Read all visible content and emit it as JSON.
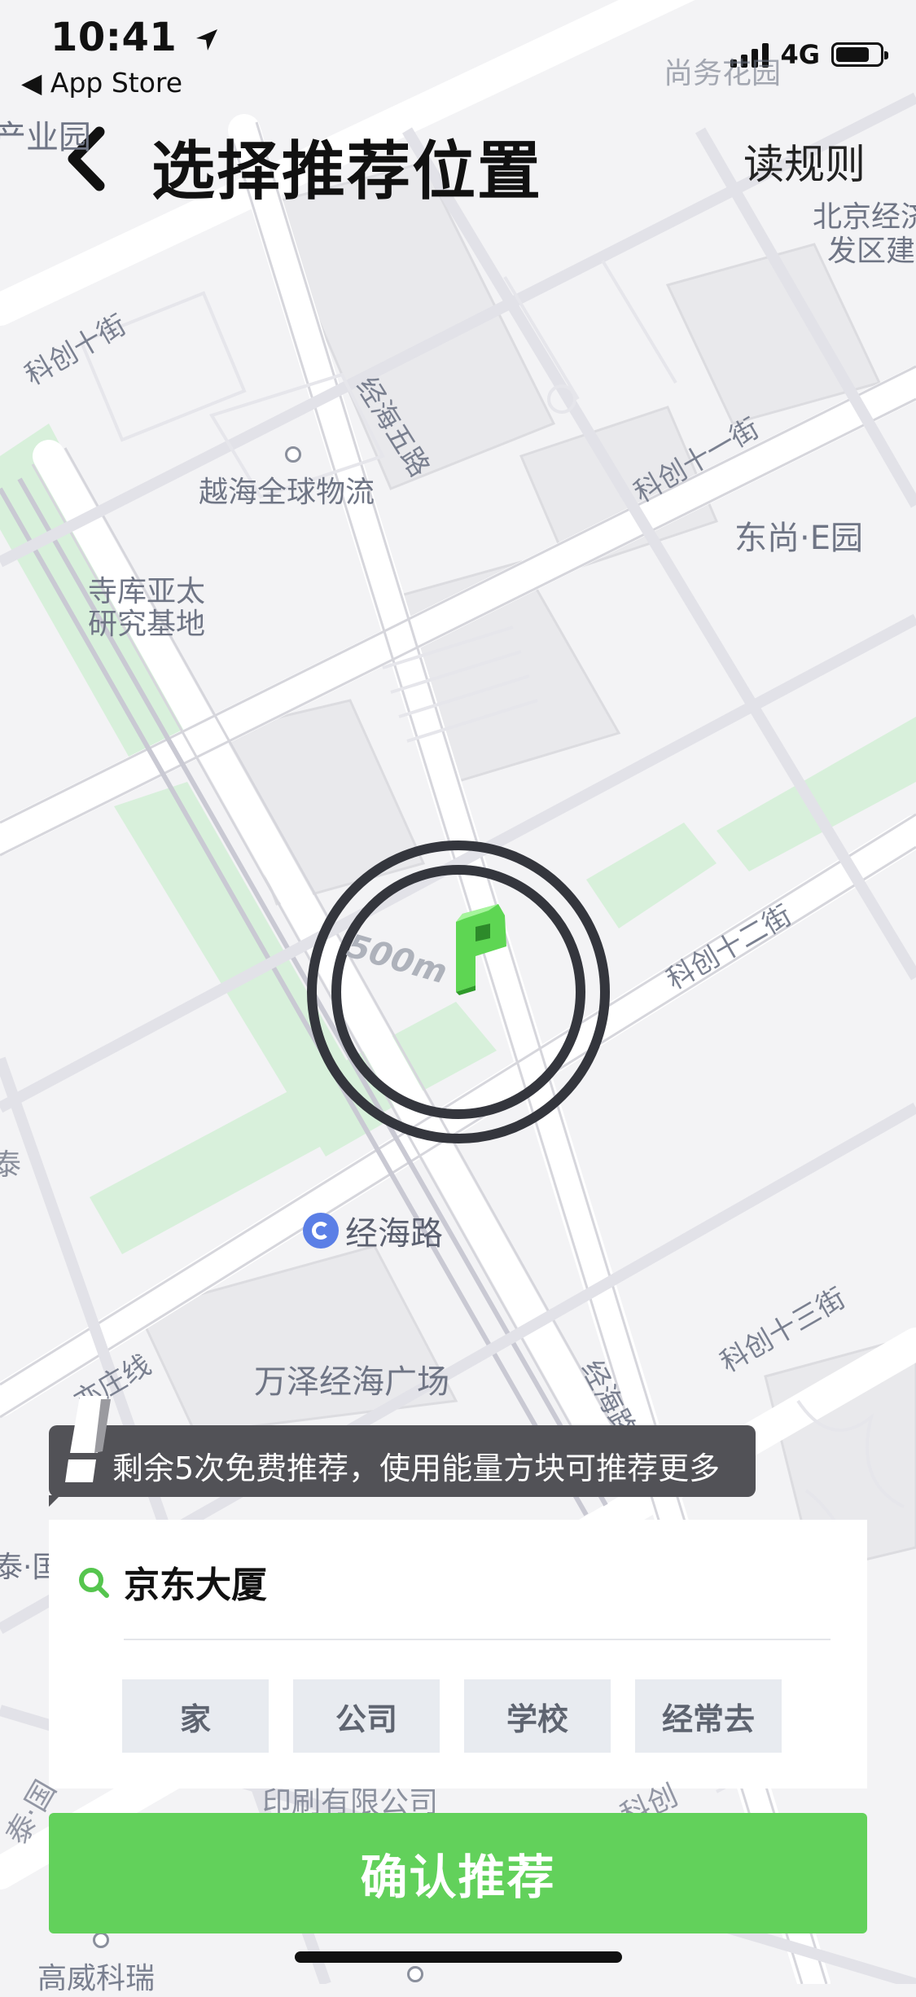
{
  "status_bar": {
    "time": "10:41",
    "back_app": "◀ App Store",
    "network": "4G",
    "battery_level": 0.8
  },
  "nav": {
    "title": "选择推荐位置",
    "rules_label": "读规则"
  },
  "map": {
    "places": {
      "industrial_park": "产业园",
      "north_cut": "尚务花园",
      "econ_zone_1": "北京经济",
      "econ_zone_2": "发区建",
      "yuehai": "越海全球物流",
      "siku_1": "寺库亚太",
      "siku_2": "研究基地",
      "dongshang": "东尚·E园",
      "wanze": "万泽经海广场",
      "left_cut": "泰·国",
      "left_cut2": "泰·国",
      "printing": "印刷有限公司",
      "gaowei": "高威科瑞"
    },
    "roads": {
      "kechuang10": "科创十街",
      "jinghai5": "经海五路",
      "kechuang11": "科创十一街",
      "kechuang12": "科创十二街",
      "kechuang13": "科创十三街",
      "yizhuang": "亦庄线",
      "jinghai_road": "经海路",
      "kechuang_cut": "科创",
      "left_a": "泰"
    },
    "subway_station": "经海路",
    "radius_label": "500m"
  },
  "tooltip": {
    "text": "剩余5次免费推荐，使用能量方块可推荐更多"
  },
  "panel": {
    "search_value": "京东大厦",
    "chips": [
      "家",
      "公司",
      "学校",
      "经常去"
    ]
  },
  "confirm_label": "确认推荐",
  "colors": {
    "accent_green": "#62d15b",
    "green_road": "#d8f0db",
    "tooltip_bg": "#525257",
    "chip_bg": "#e8ebf0"
  }
}
